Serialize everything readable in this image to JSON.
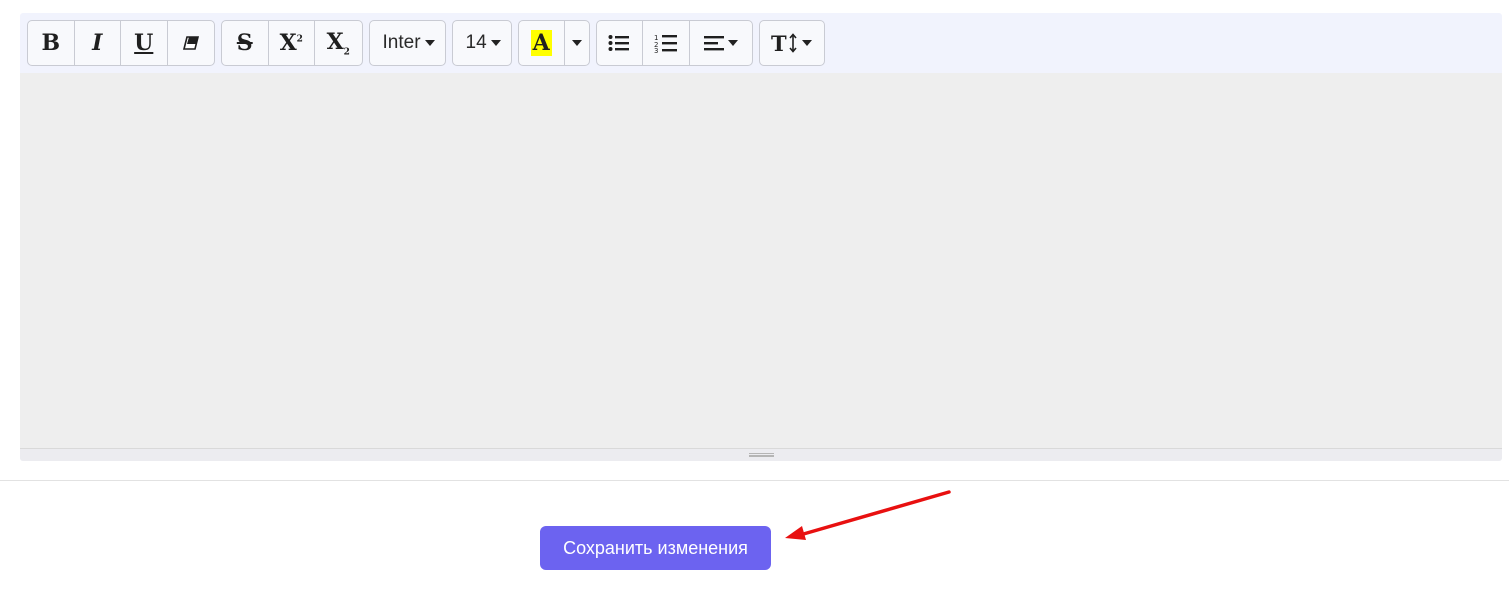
{
  "toolbar": {
    "font_family": "Inter",
    "font_size": "14",
    "highlight_color": "#ffff00",
    "groups": [
      [
        "bold-icon",
        "italic-icon",
        "underline-icon",
        "eraser-icon"
      ],
      [
        "strikethrough-icon",
        "superscript-icon",
        "subscript-icon"
      ],
      [
        "font-family-dropdown"
      ],
      [
        "font-size-dropdown"
      ],
      [
        "text-color-icon",
        "color-dropdown-caret"
      ],
      [
        "bullet-list-icon",
        "numbered-list-icon",
        "align-dropdown"
      ],
      [
        "line-height-dropdown"
      ]
    ]
  },
  "actions": {
    "save_label": "Сохранить изменения"
  },
  "annotation": {
    "arrow_color": "#e81010"
  },
  "colors": {
    "accent": "#6c63f0",
    "toolbar_bg": "#f1f3fd",
    "editor_bg": "#eeeeee"
  }
}
